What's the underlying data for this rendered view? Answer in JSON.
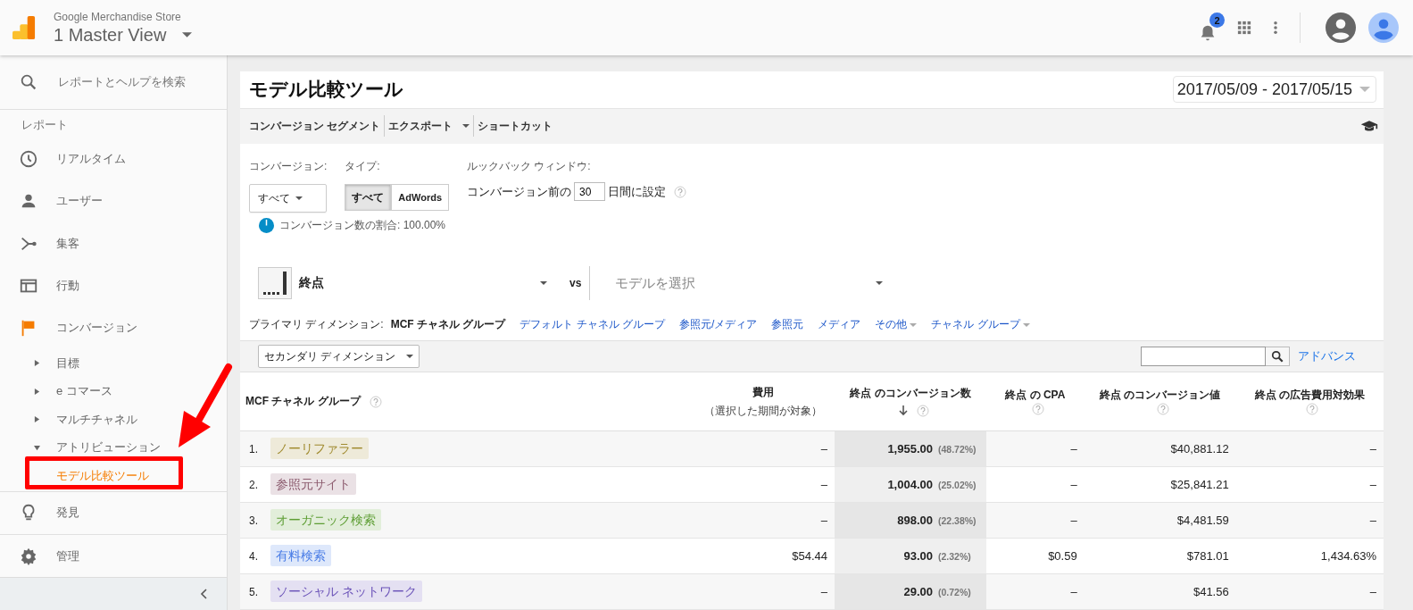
{
  "header": {
    "property": "Google Merchandise Store",
    "view": "1 Master View",
    "notification_count": "2"
  },
  "sidebar": {
    "search_placeholder": "レポートとヘルプを検索",
    "section": "レポート",
    "items": [
      {
        "kind": "clock",
        "label": "リアルタイム"
      },
      {
        "kind": "person",
        "label": "ユーザー"
      },
      {
        "kind": "fork",
        "label": "集客"
      },
      {
        "kind": "window",
        "label": "行動"
      },
      {
        "kind": "flag",
        "label": "コンバージョン",
        "expanded": true,
        "children": [
          {
            "label": "目標",
            "expanded": false,
            "selected": false
          },
          {
            "label": "e コマース",
            "expanded": false,
            "selected": false
          },
          {
            "label": "マルチチャネル",
            "expanded": false,
            "selected": false
          },
          {
            "label": "アトリビューション",
            "expanded": true,
            "selected": false,
            "children": [
              {
                "label": "モデル比較ツール",
                "selected": true
              }
            ]
          }
        ]
      },
      {
        "kind": "bulb",
        "label": "発見"
      },
      {
        "kind": "gear",
        "label": "管理"
      }
    ]
  },
  "report": {
    "title": "モデル比較ツール",
    "date_range": "2017/05/09 - 2017/05/15",
    "toolbar": [
      {
        "label": "コンバージョン セグメント",
        "dropdown": false
      },
      {
        "label": "エクスポート",
        "dropdown": true
      },
      {
        "label": "ショートカット",
        "dropdown": false
      }
    ],
    "conversion": {
      "label": "コンバージョン:",
      "value": "すべて"
    },
    "type": {
      "label": "タイプ:",
      "options": [
        {
          "label": "すべて",
          "selected": true
        },
        {
          "label": "AdWords",
          "selected": false
        }
      ]
    },
    "lookback": {
      "label": "ルックバック ウィンドウ:",
      "prefix": "コンバージョン前の",
      "value": "30",
      "suffix": "日間に設定",
      "help": true
    },
    "share": "コンバージョン数の割合: 100.00%",
    "model": {
      "value": "終点",
      "vs": "vs",
      "placeholder": "モデルを選択"
    },
    "primary_dimension": {
      "label": "プライマリ ディメンション:",
      "options": [
        {
          "label": "MCF チャネル グループ",
          "selected": true,
          "dropdown": false
        },
        {
          "label": "デフォルト チャネル グループ",
          "selected": false,
          "dropdown": false
        },
        {
          "label": "参照元/メディア",
          "selected": false,
          "dropdown": false
        },
        {
          "label": "参照元",
          "selected": false,
          "dropdown": false
        },
        {
          "label": "メディア",
          "selected": false,
          "dropdown": false
        },
        {
          "label": "その他",
          "selected": false,
          "dropdown": true
        },
        {
          "label": "チャネル グループ",
          "selected": false,
          "dropdown": true
        }
      ]
    },
    "secondary_dimension": "セカンダリ ディメンション",
    "advanced": "アドバンス",
    "table": {
      "columns": [
        {
          "label": "MCF チャネル グループ",
          "help": true
        },
        {
          "label": "費用",
          "subtitle": "（選択した期間が対象）",
          "help": false
        },
        {
          "label": "終点 のコンバージョン数",
          "help": true,
          "sorted": true
        },
        {
          "label": "終点 の CPA",
          "help": true
        },
        {
          "label": "終点 のコンバージョン値",
          "help": true
        },
        {
          "label": "終点 の広告費用対効果",
          "help": true
        }
      ],
      "rows": [
        {
          "rank": "1.",
          "channel": "ノーリファラー",
          "color": "#a08a2e",
          "cost": "–",
          "conversions": "1,955.00",
          "share": "(48.72%)",
          "cpa": "–",
          "value": "$40,881.12",
          "roas": "–"
        },
        {
          "rank": "2.",
          "channel": "参照元サイト",
          "color": "#8c5b6e",
          "cost": "–",
          "conversions": "1,004.00",
          "share": "(25.02%)",
          "cpa": "–",
          "value": "$25,841.21",
          "roas": "–"
        },
        {
          "rank": "3.",
          "channel": "オーガニック検索",
          "color": "#5e9e34",
          "cost": "–",
          "conversions": "898.00",
          "share": "(22.38%)",
          "cpa": "–",
          "value": "$4,481.59",
          "roas": "–"
        },
        {
          "rank": "4.",
          "channel": "有料検索",
          "color": "#4a7de6",
          "cost": "$54.44",
          "conversions": "93.00",
          "share": "(2.32%)",
          "cpa": "$0.59",
          "value": "$781.01",
          "roas": "1,434.63%"
        },
        {
          "rank": "5.",
          "channel": "ソーシャル ネットワーク",
          "color": "#6a52b8",
          "cost": "–",
          "conversions": "29.00",
          "share": "(0.72%)",
          "cpa": "–",
          "value": "$41.56",
          "roas": "–"
        }
      ]
    }
  }
}
